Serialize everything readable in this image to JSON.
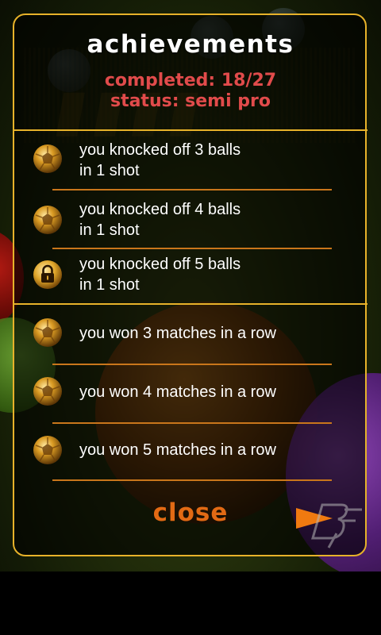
{
  "header": {
    "title": "achievements",
    "completed": "completed: 18/27",
    "status": "status: semi pro"
  },
  "achievements": [
    {
      "label": "you knocked off 3 balls\nin 1 shot",
      "icon": "gold-ball-icon",
      "unlocked": true
    },
    {
      "label": "you knocked off 4 balls\nin 1 shot",
      "icon": "gold-ball-icon",
      "unlocked": true
    },
    {
      "label": "you knocked off 5 balls\nin 1 shot",
      "icon": "lock-icon",
      "unlocked": false
    },
    {
      "label": "you won 3 matches in a row",
      "icon": "gold-ball-icon",
      "unlocked": true
    },
    {
      "label": "you won 4 matches in a row",
      "icon": "gold-ball-icon",
      "unlocked": true
    },
    {
      "label": "you won 5 matches in a row",
      "icon": "gold-ball-icon",
      "unlocked": true
    }
  ],
  "footer": {
    "close_label": "close",
    "next_icon": "arrow-right-icon",
    "logo_icon": "bf-logo-icon"
  },
  "colors": {
    "accent_gold": "#e7b22a",
    "separator": "#c9761b",
    "status_red": "#e14b4b",
    "close_orange": "#e26a14"
  }
}
